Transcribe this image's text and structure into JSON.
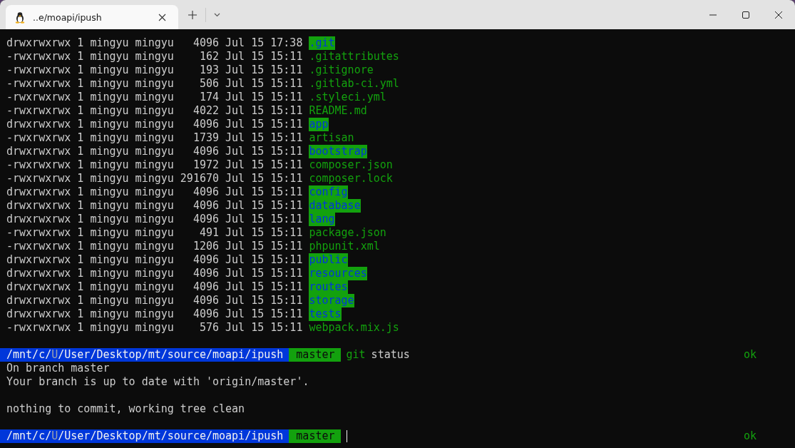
{
  "tab": {
    "title": "..e/moapi/ipush"
  },
  "listing": [
    {
      "info": "drwxrwxrwx 1 mingyu mingyu   4096 Jul 15 17:38",
      "name": ".git",
      "kind": "dir"
    },
    {
      "info": "-rwxrwxrwx 1 mingyu mingyu    162 Jul 15 15:11",
      "name": ".gitattributes",
      "kind": "file"
    },
    {
      "info": "-rwxrwxrwx 1 mingyu mingyu    193 Jul 15 15:11",
      "name": ".gitignore",
      "kind": "file"
    },
    {
      "info": "-rwxrwxrwx 1 mingyu mingyu    506 Jul 15 15:11",
      "name": ".gitlab-ci.yml",
      "kind": "file"
    },
    {
      "info": "-rwxrwxrwx 1 mingyu mingyu    174 Jul 15 15:11",
      "name": ".styleci.yml",
      "kind": "file"
    },
    {
      "info": "-rwxrwxrwx 1 mingyu mingyu   4022 Jul 15 15:11",
      "name": "README.md",
      "kind": "file"
    },
    {
      "info": "drwxrwxrwx 1 mingyu mingyu   4096 Jul 15 15:11",
      "name": "app",
      "kind": "dir"
    },
    {
      "info": "-rwxrwxrwx 1 mingyu mingyu   1739 Jul 15 15:11",
      "name": "artisan",
      "kind": "file"
    },
    {
      "info": "drwxrwxrwx 1 mingyu mingyu   4096 Jul 15 15:11",
      "name": "bootstrap",
      "kind": "dir"
    },
    {
      "info": "-rwxrwxrwx 1 mingyu mingyu   1972 Jul 15 15:11",
      "name": "composer.json",
      "kind": "file"
    },
    {
      "info": "-rwxrwxrwx 1 mingyu mingyu 291670 Jul 15 15:11",
      "name": "composer.lock",
      "kind": "file"
    },
    {
      "info": "drwxrwxrwx 1 mingyu mingyu   4096 Jul 15 15:11",
      "name": "config",
      "kind": "dir"
    },
    {
      "info": "drwxrwxrwx 1 mingyu mingyu   4096 Jul 15 15:11",
      "name": "database",
      "kind": "dir"
    },
    {
      "info": "drwxrwxrwx 1 mingyu mingyu   4096 Jul 15 15:11",
      "name": "lang",
      "kind": "dir"
    },
    {
      "info": "-rwxrwxrwx 1 mingyu mingyu    491 Jul 15 15:11",
      "name": "package.json",
      "kind": "file"
    },
    {
      "info": "-rwxrwxrwx 1 mingyu mingyu   1206 Jul 15 15:11",
      "name": "phpunit.xml",
      "kind": "file"
    },
    {
      "info": "drwxrwxrwx 1 mingyu mingyu   4096 Jul 15 15:11",
      "name": "public",
      "kind": "dir"
    },
    {
      "info": "drwxrwxrwx 1 mingyu mingyu   4096 Jul 15 15:11",
      "name": "resources",
      "kind": "dir"
    },
    {
      "info": "drwxrwxrwx 1 mingyu mingyu   4096 Jul 15 15:11",
      "name": "routes",
      "kind": "dir"
    },
    {
      "info": "drwxrwxrwx 1 mingyu mingyu   4096 Jul 15 15:11",
      "name": "storage",
      "kind": "dir"
    },
    {
      "info": "drwxrwxrwx 1 mingyu mingyu   4096 Jul 15 15:11",
      "name": "tests",
      "kind": "dir"
    },
    {
      "info": "-rwxrwxrwx 1 mingyu mingyu    576 Jul 15 15:11",
      "name": "webpack.mix.js",
      "kind": "file"
    }
  ],
  "session": [
    {
      "kind": "blank"
    },
    {
      "kind": "prompt",
      "path": [
        {
          "text": "/mnt/c/",
          "dim": false
        },
        {
          "text": "U",
          "dim": true
        },
        {
          "text": "/User/Desktop/mt/source/moapi/ipush",
          "dim": false
        }
      ],
      "branch": "master",
      "command": "git",
      "args": "status",
      "status": "ok",
      "cursor": false
    },
    {
      "kind": "output",
      "text": "On branch master"
    },
    {
      "kind": "output",
      "text": "Your branch is up to date with 'origin/master'."
    },
    {
      "kind": "blank"
    },
    {
      "kind": "output",
      "text": "nothing to commit, working tree clean"
    },
    {
      "kind": "blank"
    },
    {
      "kind": "prompt",
      "path": [
        {
          "text": "/mnt/c/",
          "dim": false
        },
        {
          "text": "U",
          "dim": true
        },
        {
          "text": "/User/Desktop/mt/source/moapi/ipush",
          "dim": false
        }
      ],
      "branch": "master",
      "status": "ok",
      "cursor": true
    }
  ]
}
